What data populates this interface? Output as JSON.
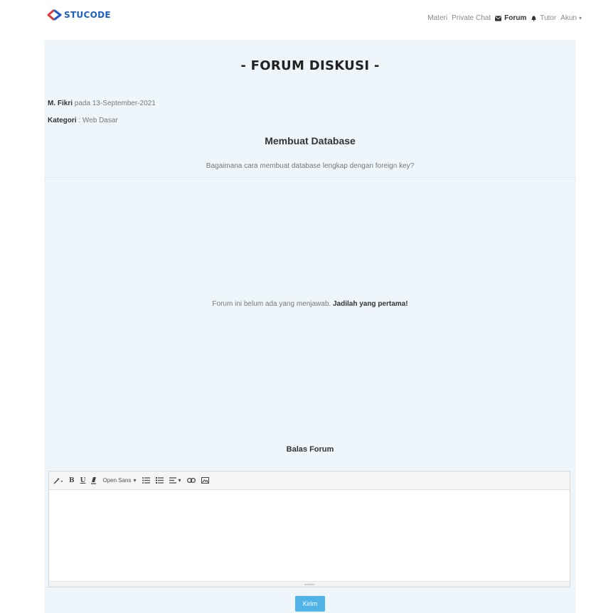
{
  "brand": {
    "name": "STUCODE",
    "color": "#1c5fc4"
  },
  "nav": {
    "materi": "Materi",
    "private_chat": "Private Chat",
    "forum": "Forum",
    "tutor": "Tutor",
    "akun": "Akun",
    "icons": {
      "forum": "envelope-icon",
      "tutor": "bell-icon",
      "akun": "caret-down-icon"
    }
  },
  "forum": {
    "page_title": "- FORUM DISKUSI -",
    "author": "M. Fikri",
    "date_prefix": "pada",
    "date": "13-September-2021",
    "category_label": "Kategori",
    "category_sep": ":",
    "category": "Web Dasar",
    "question_title": "Membuat Database",
    "question_body": "Bagaimana cara membuat database lengkap dengan foreign key?",
    "empty_text": "Forum ini belum ada yang menjawab.",
    "empty_cta": "Jadilah yang pertama!",
    "reply_title": "Balas Forum"
  },
  "editor": {
    "font_name": "Open Sans",
    "tools": [
      "magic-wand-icon",
      "bold-icon",
      "underline-icon",
      "eraser-icon",
      "font-select",
      "unordered-list-icon",
      "ordered-list-icon",
      "align-icon",
      "link-icon",
      "image-icon"
    ]
  },
  "submit": {
    "label": "Kirim",
    "color": "#4fb3e8"
  },
  "colors": {
    "panel_bg": "#eef6fb"
  }
}
